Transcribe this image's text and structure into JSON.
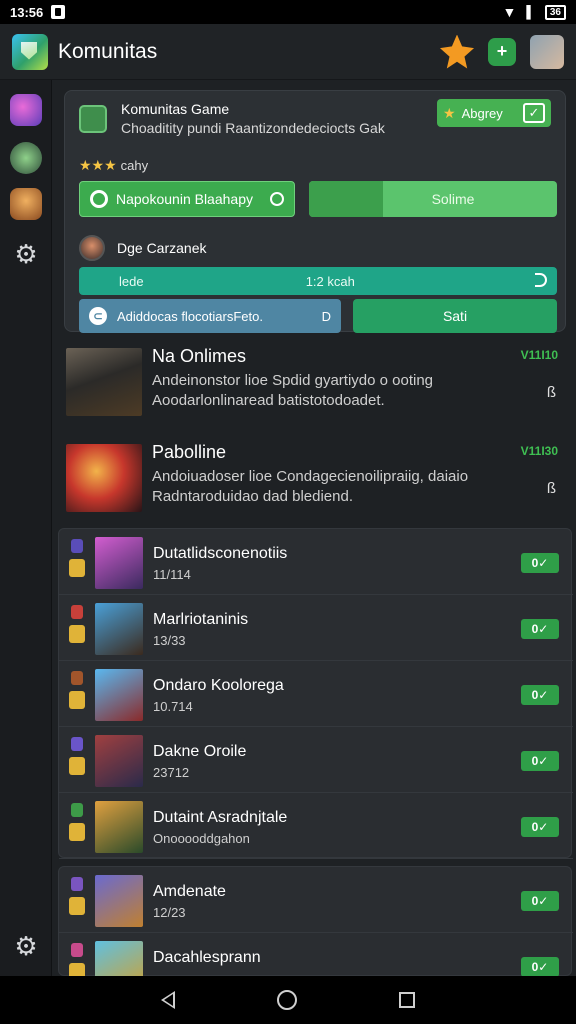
{
  "status_bar": {
    "time": "13:56",
    "battery": "36"
  },
  "app": {
    "title": "Komunitas"
  },
  "card": {
    "title": "Komunitas Game",
    "subtitle": "Choaditity pundi Raantizondedeciocts Gak",
    "apply_label": "Abgrey",
    "rating_label": "cahy",
    "primary_button": "Napokounin Blaahapy",
    "progress_label": "Solime",
    "progress_fraction": 0.3,
    "user_name": "Dge Carzanek",
    "teal_left": "lede",
    "teal_mid": "1:2 kcah",
    "link_label": "Adiddocas flocotiarsFeto.",
    "link_suffix": "D",
    "save_label": "Sati"
  },
  "featured": [
    {
      "title": "Na Onlimes",
      "line1": "Andeinonstor lioe Spdid gyartiydo o ooting",
      "line2": "Aoodarlonlinaread batistotodoadet.",
      "version": "V11I10",
      "more": "ß"
    },
    {
      "title": "Pabolline",
      "line1": "Andoiuadoser lioe Condagecienoilipraiig, daiaio",
      "line2": "Radntaroduidao dad blediend.",
      "version": "V11I30",
      "more": "ß"
    }
  ],
  "games": [
    {
      "name": "Dutatlidsconenotiis",
      "sub": "11/114",
      "ok": "0✓",
      "b1": "#5a4db8"
    },
    {
      "name": "Marlriotaninis",
      "sub": "13/33",
      "ok": "0✓",
      "b1": "#c7403a"
    },
    {
      "name": "Ondaro Koolorega",
      "sub": "10.714",
      "ok": "0✓",
      "b1": "#a1552b"
    },
    {
      "name": "Dakne Oroile",
      "sub": "23712",
      "ok": "0✓",
      "b1": "#6a55c9"
    },
    {
      "name": "Dutaint Asradnjtale",
      "sub": "Onooooddgahon",
      "ok": "0✓",
      "b1": "#3d9b48"
    },
    {
      "name": "Amdenate",
      "sub": "12/23",
      "ok": "0✓",
      "b1": "#7a55c0"
    },
    {
      "name": "Dacahlesprann",
      "sub": "",
      "ok": "0✓",
      "b1": "#c74b8c"
    }
  ],
  "icons": {
    "search": "search-icon",
    "settings": "gear-icon"
  },
  "colors": {
    "accent_green": "#3cab4e",
    "teal": "#1fa588",
    "background": "#1e2124"
  }
}
